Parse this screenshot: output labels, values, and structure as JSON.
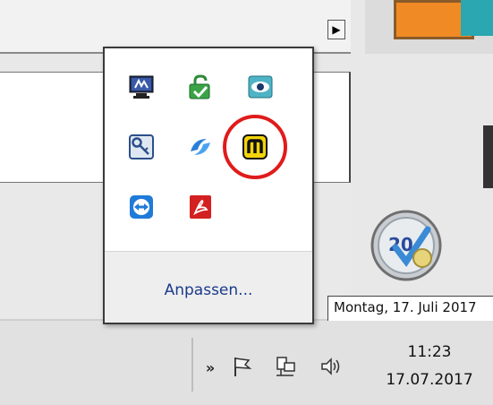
{
  "background_window": {
    "scroll_arrow_glyph": "▶"
  },
  "date_field": {
    "text": "Montag, 17. Juli 2017"
  },
  "tray_popup": {
    "customize_label": "Anpassen...",
    "icons": [
      "monitor-app-icon",
      "green-security-icon",
      "eye-app-icon",
      "key-app-icon",
      "blue-swirl-icon",
      "yellow-m-app-icon",
      "teamviewer-icon",
      "acrobat-icon"
    ],
    "highlighted_icon": "yellow-m-app-icon",
    "highlight_color": "#e01b1b"
  },
  "taskbar": {
    "overflow_glyph": "»",
    "tray_icons": [
      "flag-icon",
      "network-icon",
      "speaker-icon"
    ],
    "clock": {
      "time": "11:23",
      "date": "17.07.2017"
    }
  },
  "colors": {
    "link": "#1a3a8a",
    "taskbar": "#e1e1e1"
  }
}
